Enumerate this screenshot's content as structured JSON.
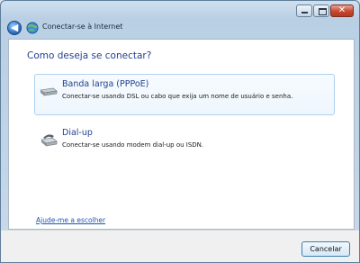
{
  "window": {
    "title": "Conectar-se à Internet",
    "controls": {
      "minimize": "",
      "maximize": "",
      "close": "✕"
    }
  },
  "nav": {
    "back_glyph": "◀"
  },
  "main": {
    "heading": "Como deseja se conectar?",
    "options": [
      {
        "title": "Banda larga (PPPoE)",
        "description": "Conectar-se usando DSL ou cabo que exija um nome de usuário e senha.",
        "icon": "broadband-modem-icon",
        "selected": true
      },
      {
        "title": "Dial-up",
        "description": "Conectar-se usando modem dial-up ou ISDN.",
        "icon": "dialup-phone-icon",
        "selected": false
      }
    ],
    "help_link": "Ajude-me a escolher"
  },
  "footer": {
    "cancel_label": "Cancelar"
  }
}
